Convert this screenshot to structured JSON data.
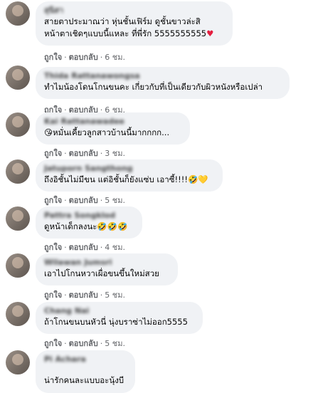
{
  "comments": [
    {
      "name": "สุนิสา",
      "text": "สายตาประมาณว่า หุ่นชั้นเฟิร์ม ดูชั้นขาวล่ะสิ\nหน้าตาเชิดๆแบบนี้แหละ ที่พี่รัก 5555555555",
      "emoji": "♥",
      "like": "ถูกใจ",
      "reply": "ตอบกลับ",
      "time": "6 ชม."
    },
    {
      "name": "Thida Rattanawongsa",
      "text": "ทำไมน้องโดนโกนขนคะ เกี่ยวกับที่เป็นเดียวกับผิวหนังหรือเปล่า",
      "emoji": "",
      "like": "ถูกใจ",
      "reply": "ตอบกลับ",
      "time": "6 ชม."
    },
    {
      "name": "Kai Rattanawadee",
      "text": "😘หมั่นเคี้ยวลูกสาวบ้านนี้มากกกก...",
      "emoji": "",
      "like": "ถูกใจ",
      "reply": "ตอบกลับ",
      "time": "3 ชม."
    },
    {
      "name": "Jatuporn Sangthong",
      "text": "ถึงอิชั้นไม่มีขน แต่อิชั้นก็ยังแซ่บ เอาซี้!!!!🤣💛",
      "emoji": "",
      "like": "ถูกใจ",
      "reply": "ตอบกลับ",
      "time": "5 ชม."
    },
    {
      "name": "Pattra Songklod",
      "text": "ดูหน้าเด็กลงนะ🤣🤣🤣",
      "emoji": "",
      "like": "ถูกใจ",
      "reply": "ตอบกลับ",
      "time": "4 ชม."
    },
    {
      "name": "Wilawan Jumsri",
      "text": "เอาไปโกนหวาเผื่อขนขึ้นใหม่สวย",
      "emoji": "",
      "like": "ถูกใจ",
      "reply": "ตอบกลับ",
      "time": "5 ชม."
    },
    {
      "name": "Chang Nai",
      "text": "ถ้าโกนขนบนหัวนี่ นุ่งบราซ่าไม่ออก5555",
      "emoji": "",
      "like": "ถูกใจ",
      "reply": "ตอบกลับ",
      "time": "5 ชม."
    },
    {
      "name": "Pi Achara",
      "text": "น่ารักคนละแบบอะนุ้งบี",
      "emoji": "",
      "like": "ถูกใจ",
      "reply": "ตอบกลับ",
      "time": ""
    }
  ]
}
